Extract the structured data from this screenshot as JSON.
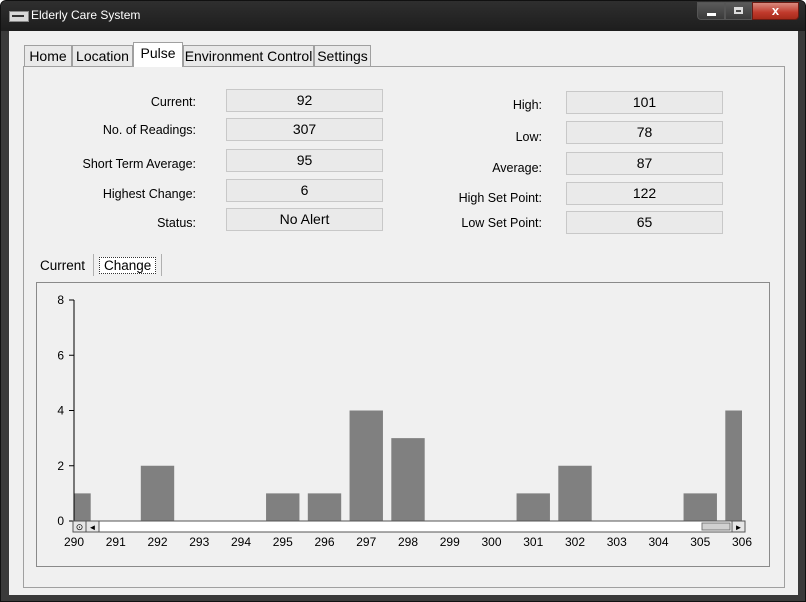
{
  "window": {
    "title": "Elderly Care System",
    "close_label": "x"
  },
  "tabs": [
    {
      "label": "Home"
    },
    {
      "label": "Location"
    },
    {
      "label": "Pulse"
    },
    {
      "label": "Environment Control"
    },
    {
      "label": "Settings"
    }
  ],
  "active_tab": "Pulse",
  "pulse": {
    "left": [
      {
        "label": "Current:",
        "value": "92"
      },
      {
        "label": "No. of Readings:",
        "value": "307"
      },
      {
        "label": "Short Term Average:",
        "value": "95"
      },
      {
        "label": "Highest Change:",
        "value": "6"
      },
      {
        "label": "Status:",
        "value": "No Alert"
      }
    ],
    "right": [
      {
        "label": "High:",
        "value": "101"
      },
      {
        "label": "Low:",
        "value": "78"
      },
      {
        "label": "Average:",
        "value": "87"
      },
      {
        "label": "High Set Point:",
        "value": "122"
      },
      {
        "label": "Low Set Point:",
        "value": "65"
      }
    ]
  },
  "chart_tabs": [
    {
      "label": "Current"
    },
    {
      "label": "Change"
    }
  ],
  "chart_data": {
    "type": "bar",
    "title": "",
    "xlabel": "",
    "ylabel": "",
    "x": [
      290,
      291,
      292,
      293,
      294,
      295,
      296,
      297,
      298,
      299,
      300,
      301,
      302,
      303,
      304,
      305,
      306
    ],
    "values": [
      1,
      0,
      2,
      0,
      0,
      1,
      1,
      4,
      3,
      0,
      0,
      1,
      2,
      0,
      0,
      1,
      4
    ],
    "xlim": [
      290,
      306
    ],
    "ylim": [
      0,
      8
    ],
    "y_ticks": [
      0,
      2,
      4,
      6,
      8
    ],
    "grid": false,
    "bar_color": "#808080"
  },
  "scrollbar": {
    "left_arrow": "◄",
    "right_arrow": "►",
    "zoom_reset": "⊙"
  }
}
